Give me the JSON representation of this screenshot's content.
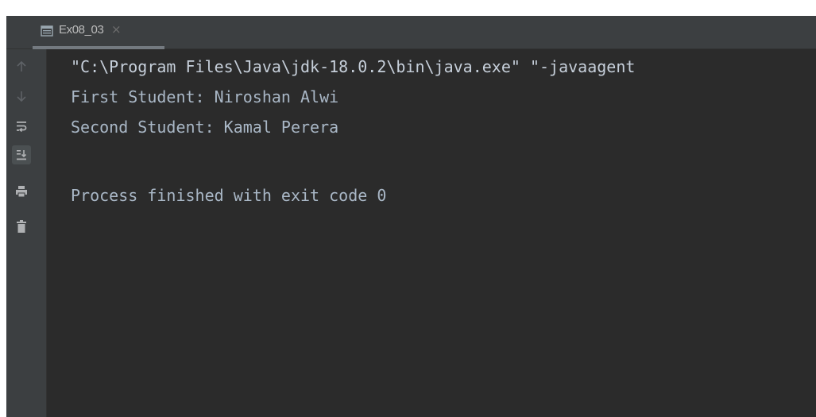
{
  "tab": {
    "label": "Ex08_03",
    "close_glyph": "×",
    "icon": "console-window-icon"
  },
  "toolbar": {
    "items": [
      {
        "name": "up-arrow-icon"
      },
      {
        "name": "down-arrow-icon"
      },
      {
        "name": "soft-wrap-icon"
      },
      {
        "name": "scroll-to-end-icon",
        "active": true
      },
      {
        "name": "print-icon"
      },
      {
        "name": "trash-icon"
      }
    ]
  },
  "console": {
    "lines": [
      "\"C:\\Program Files\\Java\\jdk-18.0.2\\bin\\java.exe\" \"-javaagent",
      "First Student: Niroshan Alwi",
      "Second Student: Kamal Perera",
      "",
      "Process finished with exit code 0"
    ]
  },
  "colors": {
    "background": "#2b2b2b",
    "panel": "#3c3f41",
    "text": "#a9b7c6",
    "icon": "#afb1b3",
    "icon_dim": "#5e6266"
  }
}
